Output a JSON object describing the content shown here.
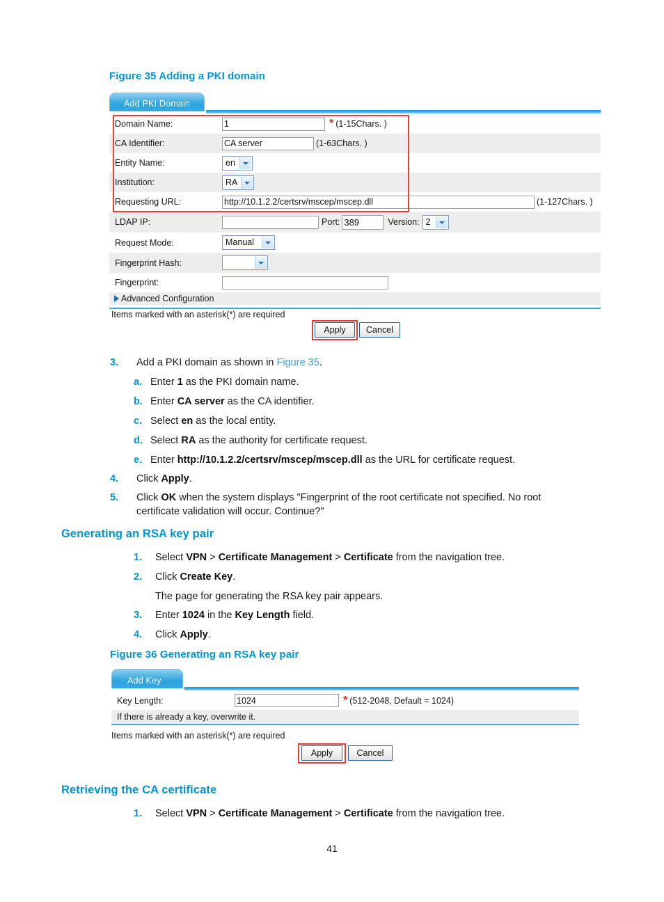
{
  "figures": {
    "fig35": {
      "caption": "Figure 35 Adding a PKI domain",
      "tab_label": "Add PKI Domain",
      "rows": {
        "domain_name": {
          "label": "Domain Name:",
          "value": "1",
          "required": "*",
          "hint": "(1-15Chars. )"
        },
        "ca_identifier": {
          "label": "CA Identifier:",
          "value": "CA server",
          "hint": "(1-63Chars. )"
        },
        "entity_name": {
          "label": "Entity Name:",
          "value": "en"
        },
        "institution": {
          "label": "Institution:",
          "value": "RA"
        },
        "requesting_url": {
          "label": "Requesting URL:",
          "value": "http://10.1.2.2/certsrv/mscep/mscep.dll",
          "hint": "(1-127Chars. )"
        },
        "ldap_ip": {
          "label": "LDAP IP:",
          "value": "",
          "port_label": "Port:",
          "port_value": "389",
          "version_label": "Version:",
          "version_value": "2"
        },
        "request_mode": {
          "label": "Request Mode:",
          "value": "Manual"
        },
        "fingerprint_hash": {
          "label": "Fingerprint Hash:",
          "value": ""
        },
        "fingerprint": {
          "label": "Fingerprint:",
          "value": ""
        }
      },
      "advanced_configuration": "Advanced Configuration",
      "asterisk_note": "Items marked with an asterisk(*) are required",
      "apply_label": "Apply",
      "cancel_label": "Cancel"
    },
    "fig36": {
      "caption": "Figure 36 Generating an RSA key pair",
      "tab_label": "Add Key",
      "rows": {
        "key_length": {
          "label": "Key Length:",
          "value": "1024",
          "required": "*",
          "hint": "(512-2048, Default = 1024)"
        }
      },
      "overwrite_note": "If there is already a key, overwrite it.",
      "asterisk_note": "Items marked with an asterisk(*) are required",
      "apply_label": "Apply",
      "cancel_label": "Cancel"
    }
  },
  "steps_pki": {
    "s3": {
      "marker": "3.",
      "pre": "Add a PKI domain as shown in ",
      "link": "Figure 35",
      "post": "."
    },
    "a": {
      "marker": "a.",
      "pre": "Enter ",
      "bold": "1",
      "post": " as the PKI domain name."
    },
    "b": {
      "marker": "b.",
      "pre": "Enter ",
      "bold": "CA server",
      "post": " as the CA identifier."
    },
    "c": {
      "marker": "c.",
      "pre": "Select ",
      "bold": "en",
      "post": " as the local entity."
    },
    "d": {
      "marker": "d.",
      "pre": "Select ",
      "bold": "RA",
      "post": " as the authority for certificate request."
    },
    "e": {
      "marker": "e.",
      "pre": "Enter ",
      "bold": "http://10.1.2.2/certsrv/mscep/mscep.dll",
      "post": " as the URL for certificate request."
    },
    "s4": {
      "marker": "4.",
      "pre": "Click ",
      "bold": "Apply",
      "post": "."
    },
    "s5": {
      "marker": "5.",
      "pre": "Click ",
      "bold": "OK",
      "post": " when the system displays \"Fingerprint of the root certificate not specified. No root",
      "line2": "certificate validation will occur. Continue?\""
    }
  },
  "section_rsa": {
    "heading": "Generating an RSA key pair",
    "s1": {
      "marker": "1.",
      "pre": "Select ",
      "b1": "VPN",
      "sep1": " > ",
      "b2": "Certificate Management",
      "sep2": " > ",
      "b3": "Certificate",
      "post": " from the navigation tree."
    },
    "s2": {
      "marker": "2.",
      "pre": "Click ",
      "bold": "Create Key",
      "post": "."
    },
    "s2_note": "The page for generating the RSA key pair appears.",
    "s3": {
      "marker": "3.",
      "pre": "Enter ",
      "b1": "1024",
      "mid": " in the ",
      "b2": "Key Length",
      "post": " field."
    },
    "s4": {
      "marker": "4.",
      "pre": "Click ",
      "bold": "Apply",
      "post": "."
    }
  },
  "section_ca": {
    "heading": "Retrieving the CA certificate",
    "s1": {
      "marker": "1.",
      "pre": "Select ",
      "b1": "VPN",
      "sep1": " > ",
      "b2": "Certificate Management",
      "sep2": " > ",
      "b3": "Certificate",
      "post": " from the navigation tree."
    }
  },
  "page_number": "41",
  "colors": {
    "accent_blue": "#0096d6",
    "link_blue": "#3aa3dd",
    "required_red": "#e8241c",
    "highlight_red": "#ef3b34",
    "row_stripe": "#ededed"
  }
}
